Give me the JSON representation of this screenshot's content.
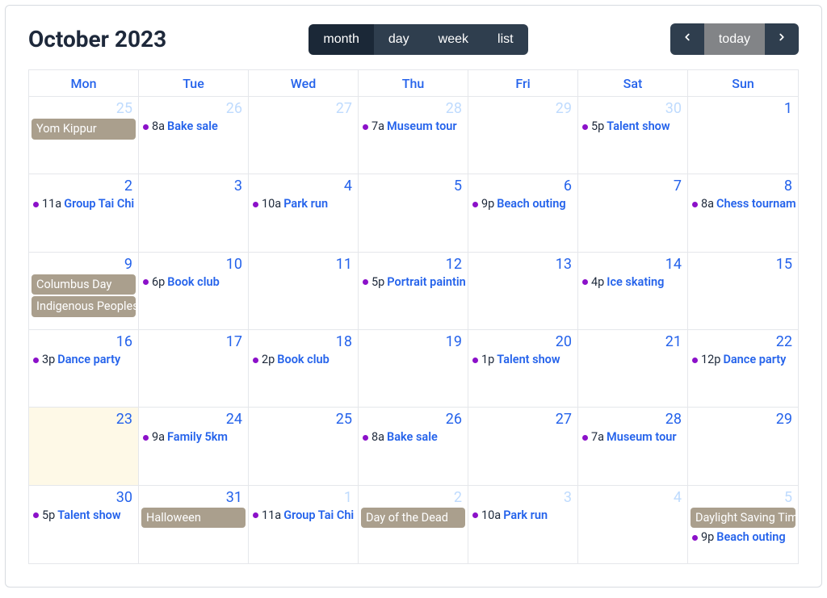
{
  "header": {
    "title": "October 2023",
    "views": {
      "month": "month",
      "day": "day",
      "week": "week",
      "list": "list",
      "active": "month"
    },
    "nav": {
      "prev_icon": "chevron-left",
      "next_icon": "chevron-right",
      "today": "today"
    }
  },
  "colors": {
    "event_dot": "#8b11c9",
    "allday_bg": "#aa9f8d",
    "link_blue": "#2563eb"
  },
  "day_headers": [
    "Mon",
    "Tue",
    "Wed",
    "Thu",
    "Fri",
    "Sat",
    "Sun"
  ],
  "today_date": "2023-10-23",
  "weeks": [
    [
      {
        "date": "2023-09-25",
        "num": "25",
        "other_month": true,
        "events": [
          {
            "allday": true,
            "title": "Yom Kippur"
          }
        ]
      },
      {
        "date": "2023-09-26",
        "num": "26",
        "other_month": true,
        "events": [
          {
            "time": "8a",
            "title": "Bake sale"
          }
        ]
      },
      {
        "date": "2023-09-27",
        "num": "27",
        "other_month": true,
        "events": []
      },
      {
        "date": "2023-09-28",
        "num": "28",
        "other_month": true,
        "events": [
          {
            "time": "7a",
            "title": "Museum tour"
          }
        ]
      },
      {
        "date": "2023-09-29",
        "num": "29",
        "other_month": true,
        "events": []
      },
      {
        "date": "2023-09-30",
        "num": "30",
        "other_month": true,
        "events": [
          {
            "time": "5p",
            "title": "Talent show"
          }
        ]
      },
      {
        "date": "2023-10-01",
        "num": "1",
        "other_month": false,
        "events": []
      }
    ],
    [
      {
        "date": "2023-10-02",
        "num": "2",
        "other_month": false,
        "events": [
          {
            "time": "11a",
            "title": "Group Tai Chi"
          }
        ]
      },
      {
        "date": "2023-10-03",
        "num": "3",
        "other_month": false,
        "events": []
      },
      {
        "date": "2023-10-04",
        "num": "4",
        "other_month": false,
        "events": [
          {
            "time": "10a",
            "title": "Park run"
          }
        ]
      },
      {
        "date": "2023-10-05",
        "num": "5",
        "other_month": false,
        "events": []
      },
      {
        "date": "2023-10-06",
        "num": "6",
        "other_month": false,
        "events": [
          {
            "time": "9p",
            "title": "Beach outing"
          }
        ]
      },
      {
        "date": "2023-10-07",
        "num": "7",
        "other_month": false,
        "events": []
      },
      {
        "date": "2023-10-08",
        "num": "8",
        "other_month": false,
        "events": [
          {
            "time": "8a",
            "title": "Chess tournament"
          }
        ]
      }
    ],
    [
      {
        "date": "2023-10-09",
        "num": "9",
        "other_month": false,
        "events": [
          {
            "allday": true,
            "title": "Columbus Day"
          },
          {
            "allday": true,
            "title": "Indigenous Peoples' Day"
          }
        ]
      },
      {
        "date": "2023-10-10",
        "num": "10",
        "other_month": false,
        "events": [
          {
            "time": "6p",
            "title": "Book club"
          }
        ]
      },
      {
        "date": "2023-10-11",
        "num": "11",
        "other_month": false,
        "events": []
      },
      {
        "date": "2023-10-12",
        "num": "12",
        "other_month": false,
        "events": [
          {
            "time": "5p",
            "title": "Portrait painting"
          }
        ]
      },
      {
        "date": "2023-10-13",
        "num": "13",
        "other_month": false,
        "events": []
      },
      {
        "date": "2023-10-14",
        "num": "14",
        "other_month": false,
        "events": [
          {
            "time": "4p",
            "title": "Ice skating"
          }
        ]
      },
      {
        "date": "2023-10-15",
        "num": "15",
        "other_month": false,
        "events": []
      }
    ],
    [
      {
        "date": "2023-10-16",
        "num": "16",
        "other_month": false,
        "events": [
          {
            "time": "3p",
            "title": "Dance party"
          }
        ]
      },
      {
        "date": "2023-10-17",
        "num": "17",
        "other_month": false,
        "events": []
      },
      {
        "date": "2023-10-18",
        "num": "18",
        "other_month": false,
        "events": [
          {
            "time": "2p",
            "title": "Book club"
          }
        ]
      },
      {
        "date": "2023-10-19",
        "num": "19",
        "other_month": false,
        "events": []
      },
      {
        "date": "2023-10-20",
        "num": "20",
        "other_month": false,
        "events": [
          {
            "time": "1p",
            "title": "Talent show"
          }
        ]
      },
      {
        "date": "2023-10-21",
        "num": "21",
        "other_month": false,
        "events": []
      },
      {
        "date": "2023-10-22",
        "num": "22",
        "other_month": false,
        "events": [
          {
            "time": "12p",
            "title": "Dance party"
          }
        ]
      }
    ],
    [
      {
        "date": "2023-10-23",
        "num": "23",
        "other_month": false,
        "is_today": true,
        "events": []
      },
      {
        "date": "2023-10-24",
        "num": "24",
        "other_month": false,
        "events": [
          {
            "time": "9a",
            "title": "Family 5km"
          }
        ]
      },
      {
        "date": "2023-10-25",
        "num": "25",
        "other_month": false,
        "events": []
      },
      {
        "date": "2023-10-26",
        "num": "26",
        "other_month": false,
        "events": [
          {
            "time": "8a",
            "title": "Bake sale"
          }
        ]
      },
      {
        "date": "2023-10-27",
        "num": "27",
        "other_month": false,
        "events": []
      },
      {
        "date": "2023-10-28",
        "num": "28",
        "other_month": false,
        "events": [
          {
            "time": "7a",
            "title": "Museum tour"
          }
        ]
      },
      {
        "date": "2023-10-29",
        "num": "29",
        "other_month": false,
        "events": []
      }
    ],
    [
      {
        "date": "2023-10-30",
        "num": "30",
        "other_month": false,
        "events": [
          {
            "time": "5p",
            "title": "Talent show"
          }
        ]
      },
      {
        "date": "2023-10-31",
        "num": "31",
        "other_month": false,
        "events": [
          {
            "allday": true,
            "title": "Halloween"
          }
        ]
      },
      {
        "date": "2023-11-01",
        "num": "1",
        "other_month": true,
        "events": [
          {
            "time": "11a",
            "title": "Group Tai Chi"
          }
        ]
      },
      {
        "date": "2023-11-02",
        "num": "2",
        "other_month": true,
        "events": [
          {
            "allday": true,
            "title": "Day of the Dead"
          }
        ]
      },
      {
        "date": "2023-11-03",
        "num": "3",
        "other_month": true,
        "events": [
          {
            "time": "10a",
            "title": "Park run"
          }
        ]
      },
      {
        "date": "2023-11-04",
        "num": "4",
        "other_month": true,
        "events": []
      },
      {
        "date": "2023-11-05",
        "num": "5",
        "other_month": true,
        "events": [
          {
            "allday": true,
            "title": "Daylight Saving Time ends"
          },
          {
            "time": "9p",
            "title": "Beach outing"
          }
        ]
      }
    ]
  ]
}
